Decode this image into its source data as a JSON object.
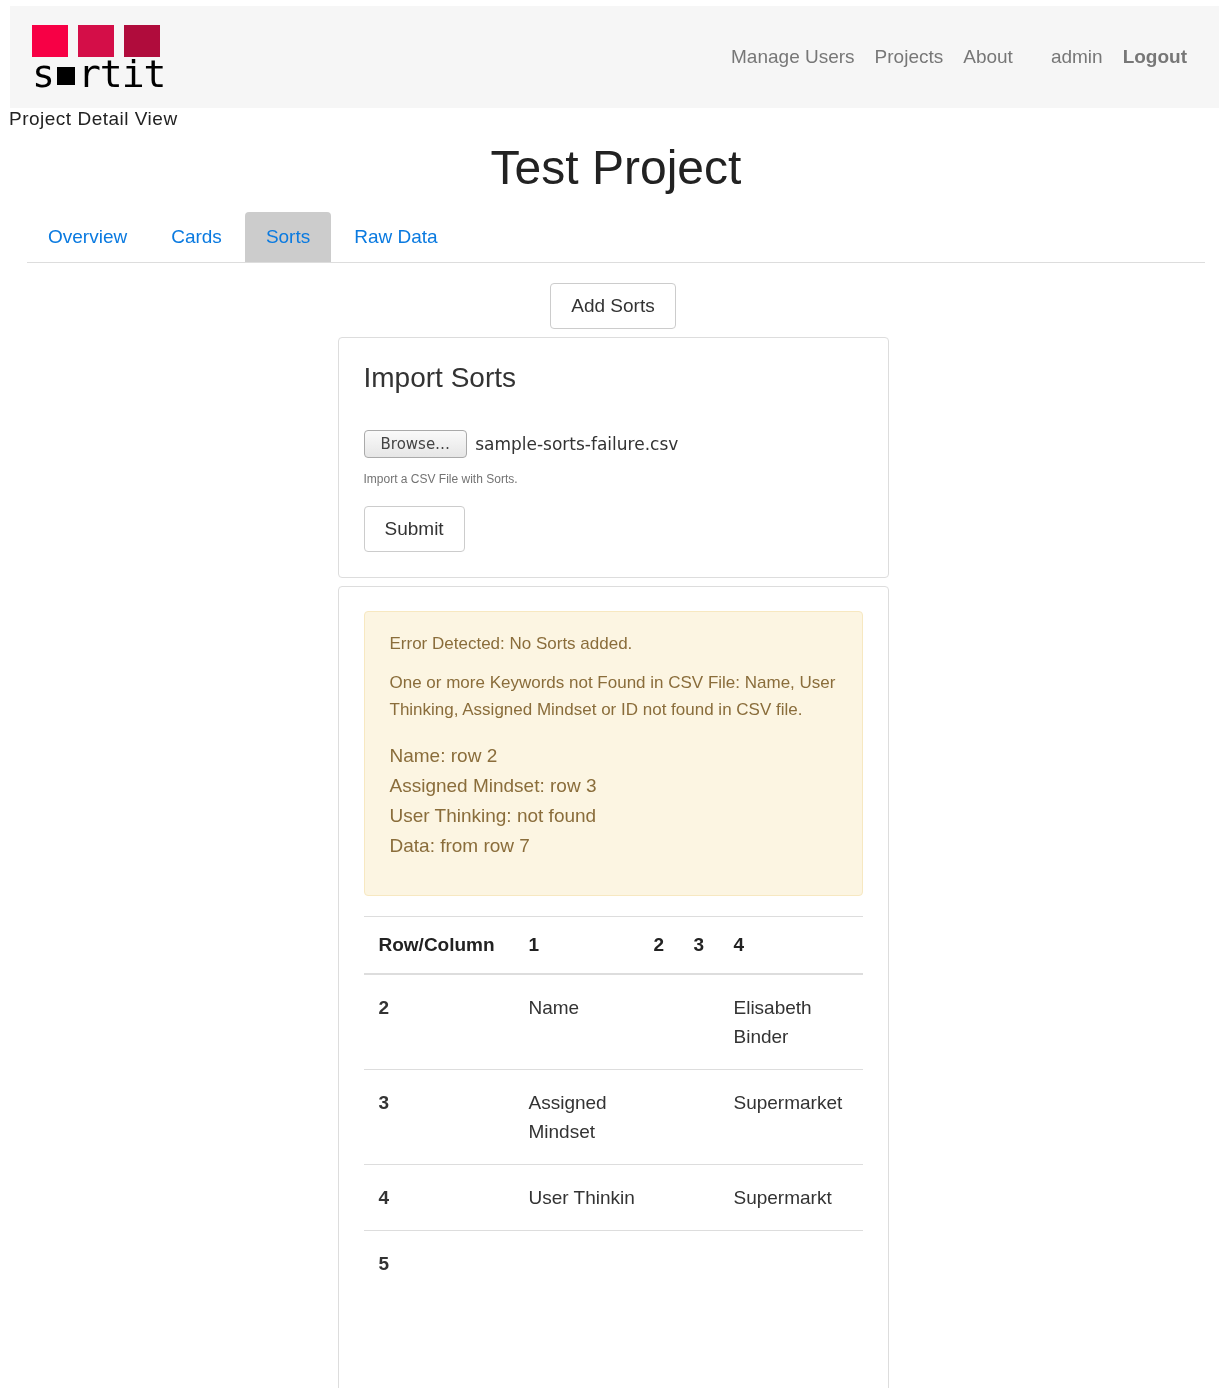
{
  "logo": {
    "before": "s",
    "after": "rtit"
  },
  "nav": [
    {
      "label": "Manage Users",
      "kind": "link"
    },
    {
      "label": "Projects",
      "kind": "link"
    },
    {
      "label": "About",
      "kind": "link"
    },
    {
      "label": "admin",
      "kind": "user"
    },
    {
      "label": "Logout",
      "kind": "action"
    }
  ],
  "page_label": "Project Detail View",
  "title": "Test Project",
  "tabs": [
    {
      "label": "Overview",
      "selected": false
    },
    {
      "label": "Cards",
      "selected": false
    },
    {
      "label": "Sorts",
      "selected": true
    },
    {
      "label": "Raw Data",
      "selected": false
    }
  ],
  "add_button": "Add Sorts",
  "import": {
    "heading": "Import Sorts",
    "browse_button": "Browse…",
    "file_name": "sample-sorts-failure.csv",
    "help": "Import a CSV File with Sorts.",
    "submit_button": "Submit"
  },
  "alert": {
    "title": "Error Detected: No Sorts added.",
    "message": "One or more Keywords not Found in CSV File: Name, User Thinking, Assigned Mindset or ID not found in CSV file.",
    "details": [
      "Name: row 2",
      "Assigned Mindset: row 3",
      "User Thinking: not found",
      "Data: from row 7"
    ]
  },
  "table": {
    "columns": [
      "Row/Column",
      "1",
      "2",
      "3",
      "4"
    ],
    "rows": [
      {
        "row": "2",
        "column_1": "Name",
        "column_4": "Elisabeth Binder"
      },
      {
        "row": "3",
        "column_1": "Assigned Mindset",
        "column_4": "Supermarket"
      },
      {
        "row": "4",
        "column_1": "User Thinkin",
        "column_4": "Supermarkt"
      },
      {
        "row": "5"
      }
    ]
  }
}
